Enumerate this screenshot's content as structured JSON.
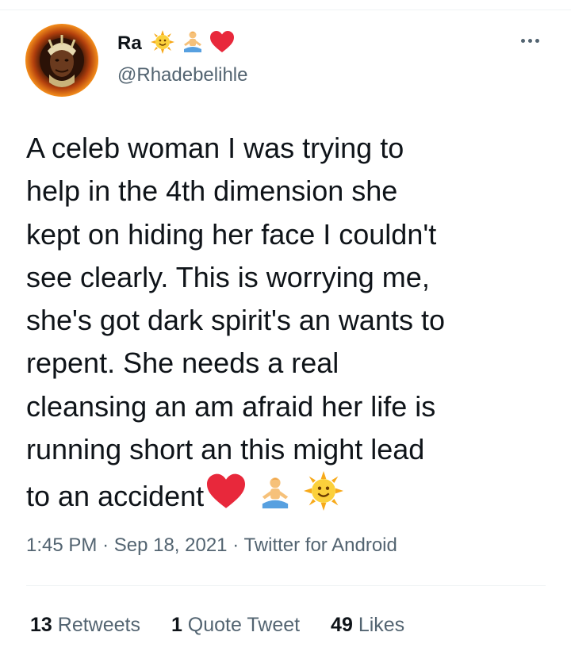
{
  "author": {
    "display_name": "Ra",
    "handle": "@Rhadebelihle",
    "name_emoji": [
      "sun-face-icon",
      "person-in-lotus-position-icon",
      "red-heart-icon"
    ]
  },
  "tweet": {
    "lines": [
      "A celeb woman I was trying to",
      "help in the 4th dimension she",
      "kept on hiding her face I couldn't",
      "see clearly. This is worrying me,",
      "she's got dark spirit's an wants to",
      "repent. She needs a real",
      "cleansing an am afraid her life is",
      "running short an this might lead",
      "to an accident"
    ],
    "trailing_emoji": [
      "red-heart-icon",
      "person-in-lotus-position-icon",
      "sun-face-icon"
    ]
  },
  "meta": {
    "time": "1:45 PM",
    "date": "Sep 18, 2021",
    "source": "Twitter for Android",
    "separator": "·"
  },
  "stats": {
    "retweets_count": "13",
    "retweets_label": "Retweets",
    "quotes_count": "1",
    "quotes_label": "Quote Tweet",
    "likes_count": "49",
    "likes_label": "Likes"
  },
  "colors": {
    "text": "#0f1419",
    "secondary": "#536471",
    "divider": "#eff3f4",
    "heart": "#e8283b",
    "sun": "#f7c325"
  }
}
